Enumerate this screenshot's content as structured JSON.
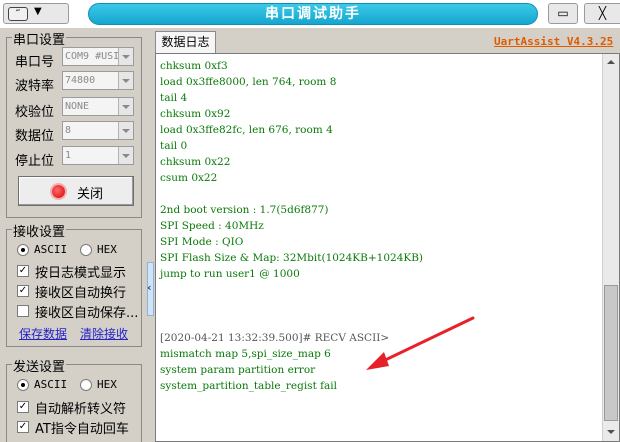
{
  "titlebar": {
    "title": "串口调试助手",
    "sysmenu_icon": "app-icon",
    "sysmenu_glyph": "‴",
    "sysmenu_arrow": "▼",
    "minimize_glyph": "▭",
    "close_glyph": "╳"
  },
  "serial": {
    "group_title": "串口设置",
    "port_label": "串口号",
    "port_value": "COM9 #USI",
    "baud_label": "波特率",
    "baud_value": "74800",
    "parity_label": "校验位",
    "parity_value": "NONE",
    "databits_label": "数据位",
    "databits_value": "8",
    "stopbits_label": "停止位",
    "stopbits_value": "1",
    "close_button": "关闭",
    "status_color": "#d80000"
  },
  "receive": {
    "group_title": "接收设置",
    "ascii": "ASCII",
    "hex": "HEX",
    "log_mode": "按日志模式显示",
    "auto_wrap": "接收区自动换行",
    "save": "接收区自动保存...",
    "save_link": "保存数据",
    "clear_link": "清除接收"
  },
  "send": {
    "group_title": "发送设置",
    "ascii": "ASCII",
    "hex": "HEX",
    "auto_escape": "自动解析转义符",
    "at_newline": "AT指令自动回车"
  },
  "tab": {
    "label": "数据日志"
  },
  "brand": "UartAssist V4.3.25",
  "log": {
    "lines": [
      "chksum 0xf3",
      "load 0x3ffe8000, len 764, room 8",
      "tail 4",
      "chksum 0x92",
      "load 0x3ffe82fc, len 676, room 4",
      "tail 0",
      "chksum 0x22",
      "csum 0x22",
      "",
      "2nd boot version : 1.7(5d6f877)",
      "SPI Speed : 40MHz",
      "SPI Mode : QIO",
      "SPI Flash Size & Map: 32Mbit(1024KB+1024KB)",
      "jump to run user1 @ 1000",
      "",
      "",
      "",
      "[2020-04-21 13:32:39.500]# RECV ASCII>",
      "mismatch map 5,spi_size_map 6",
      "system param partition error",
      "system_partition_table_regist fail"
    ],
    "recv_line_index": 17
  },
  "colors": {
    "log_text": "#0a7a0a",
    "title_bar": "#15a6cf",
    "brand": "#e05a00",
    "annotation_arrow": "#e8202a"
  }
}
